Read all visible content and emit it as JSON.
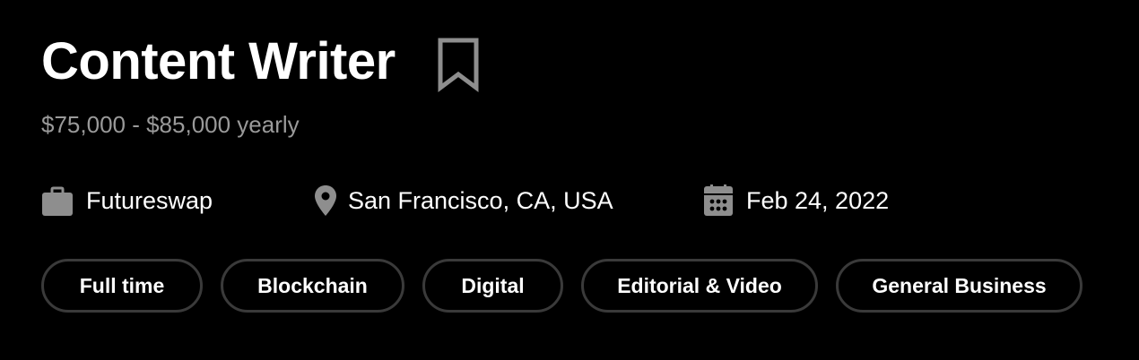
{
  "job": {
    "title": "Content Writer",
    "salary": "$75,000 - $85,000 yearly",
    "bookmark_icon": "bookmark-icon"
  },
  "meta": {
    "company": {
      "icon": "briefcase-icon",
      "text": "Futureswap"
    },
    "location": {
      "icon": "map-pin-icon",
      "text": "San Francisco, CA, USA"
    },
    "date": {
      "icon": "calendar-icon",
      "text": "Feb 24, 2022"
    }
  },
  "tags": [
    {
      "label": "Full time"
    },
    {
      "label": "Blockchain"
    },
    {
      "label": "Digital"
    },
    {
      "label": "Editorial & Video"
    },
    {
      "label": "General Business"
    }
  ],
  "colors": {
    "background": "#000000",
    "text": "#ffffff",
    "muted_text": "#9a9a9a",
    "icon": "#8e8e8e",
    "tag_border": "#3a3a3a"
  }
}
